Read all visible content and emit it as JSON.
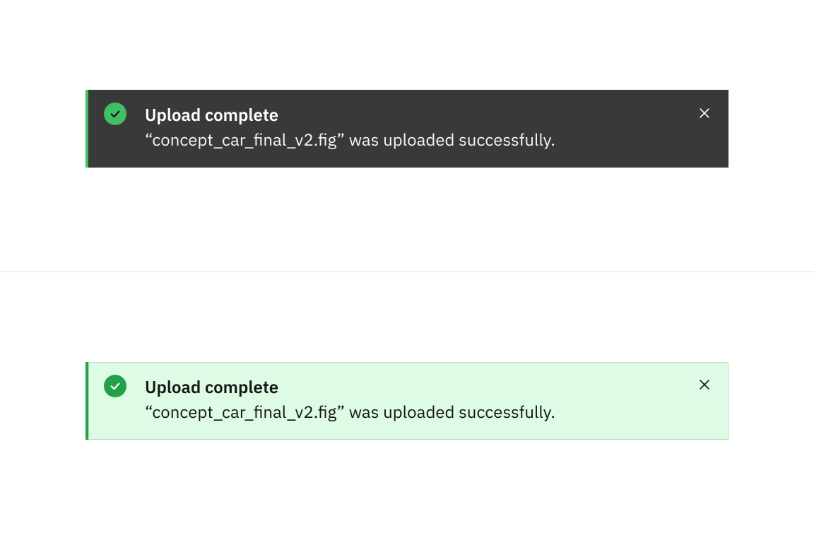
{
  "notifications": [
    {
      "variant": "dark",
      "title": "Upload complete",
      "message": "“concept_car_final_v2.fig” was uploaded successfully.",
      "status_icon": "checkmark-filled",
      "close_icon": "close"
    },
    {
      "variant": "light",
      "title": "Upload complete",
      "message": "“concept_car_final_v2.fig” was uploaded successfully.",
      "status_icon": "checkmark-filled",
      "close_icon": "close"
    }
  ],
  "colors": {
    "success_dark_accent": "#42be65",
    "success_light_accent": "#24a148",
    "toast_dark_bg": "#393939",
    "toast_light_bg": "#defbe6",
    "divider": "#e0e0e0"
  }
}
